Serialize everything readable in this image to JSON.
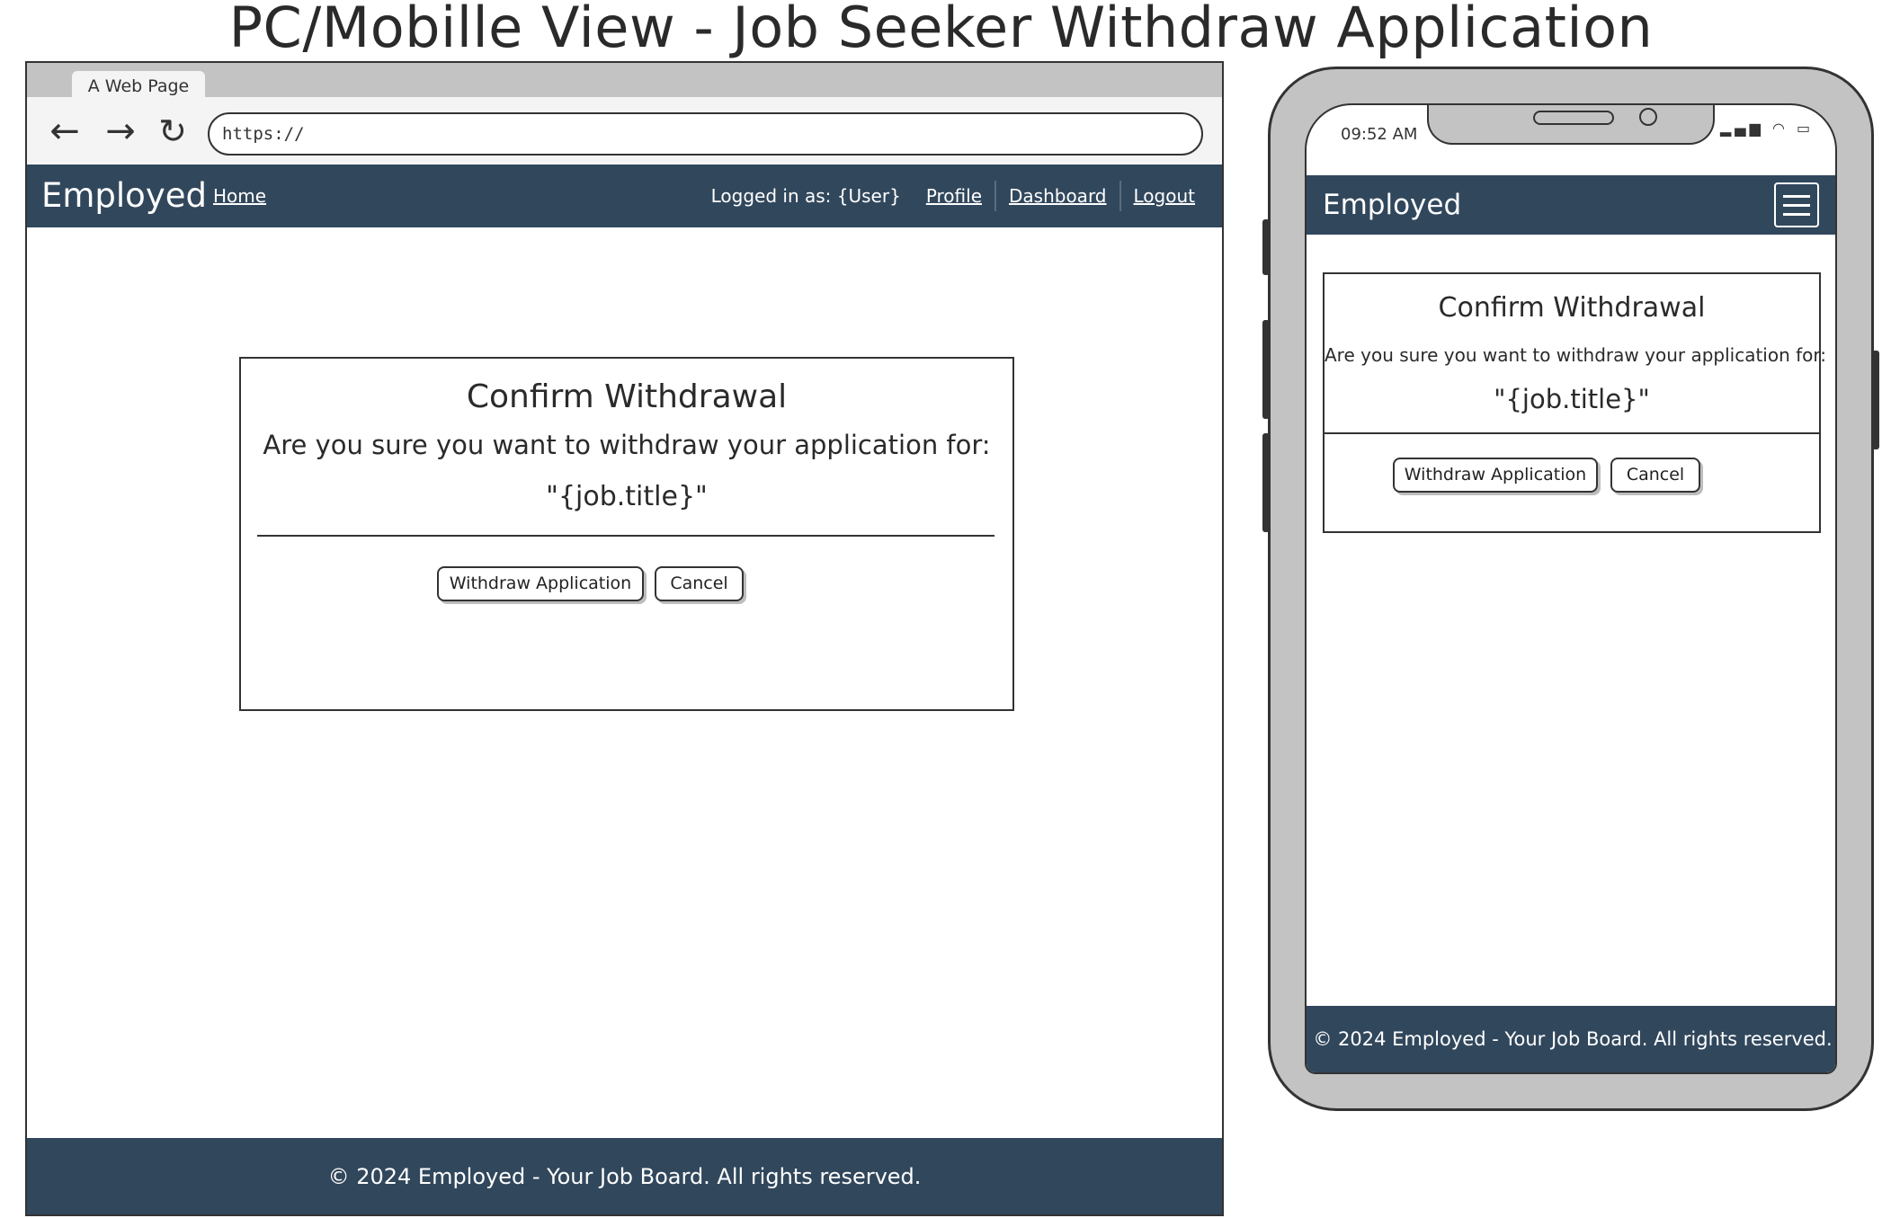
{
  "page": {
    "title": "PC/Mobille View - Job Seeker Withdraw Application"
  },
  "browser": {
    "tab_label": "A Web Page",
    "url": "https://",
    "back_icon": "arrow-left-icon",
    "forward_icon": "arrow-right-icon",
    "reload_icon": "reload-icon",
    "back_glyph": "←",
    "forward_glyph": "→",
    "reload_glyph": "↻"
  },
  "desktop": {
    "navbar": {
      "brand": "Employed",
      "home": "Home",
      "logged_in": "Logged in as: {User}",
      "profile": "Profile",
      "dashboard": "Dashboard",
      "logout": "Logout"
    },
    "modal": {
      "title": "Confirm Withdrawal",
      "message": "Are you sure you want to withdraw your application for:",
      "job_title": "\"{job.title}\"",
      "withdraw_button": "Withdraw Application",
      "cancel_button": "Cancel"
    },
    "footer": "© 2024 Employed - Your Job Board. All rights reserved."
  },
  "mobile": {
    "status": {
      "time": "09:52 AM",
      "icons_glyph": "▂▄▆ ◠ ▭"
    },
    "navbar": {
      "brand": "Employed",
      "menu_icon": "hamburger-menu-icon"
    },
    "modal": {
      "title": "Confirm Withdrawal",
      "message": "Are you sure you want to withdraw your application for:",
      "job_title": "\"{job.title}\"",
      "withdraw_button": "Withdraw Application",
      "cancel_button": "Cancel"
    },
    "footer": "© 2024 Employed - Your Job Board. All rights reserved."
  },
  "colors": {
    "navbar_bg": "#31475c",
    "chrome_gray": "#c3c3c3",
    "outline": "#333333"
  }
}
